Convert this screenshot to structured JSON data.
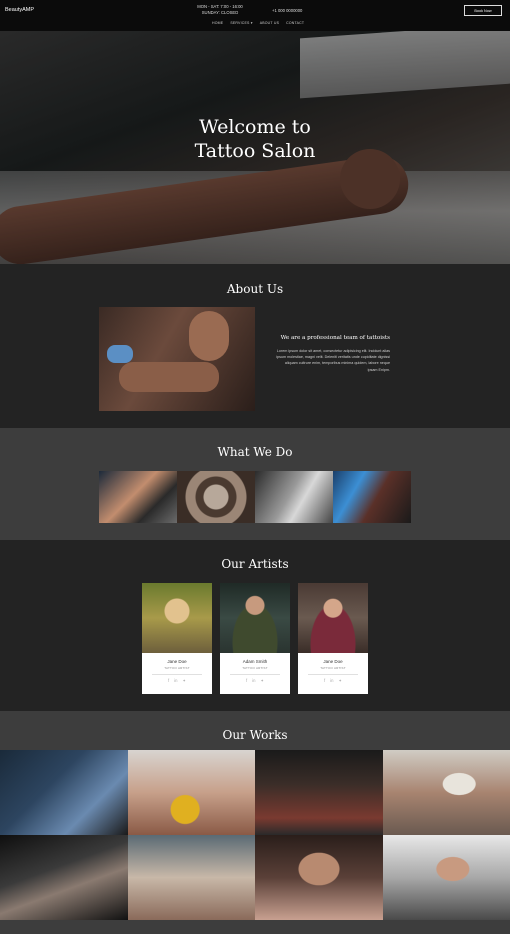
{
  "header": {
    "logo": "BeautyAMP",
    "hours_line1": "MON - SAT: 7:00 - 16:00",
    "hours_line2": "SUNDAY: CLOSED",
    "phone": "+1 000 0000000",
    "book_label": "Book Now",
    "nav": [
      "HOME",
      "SERVICES ▾",
      "ABOUT US",
      "CONTACT"
    ]
  },
  "hero": {
    "title_line1": "Welcome to",
    "title_line2": "Tattoo Salon"
  },
  "about": {
    "title": "About Us",
    "subtitle": "We are a professional team of tattoists",
    "body": "Lorem ipsum dolor sit amet, consectetur adipisicing elit. Incidunt alias ipsum molestiae, magni velit. Deleniti veritatis unde cupiditate dignissi aliquam cultrure enim, temporibus minima quidem, labore neque ipsam Enipm."
  },
  "whatwedo": {
    "title": "What We Do"
  },
  "artists": {
    "title": "Our Artists",
    "items": [
      {
        "name": "Jane Doe",
        "role": "TATTOO ARTIST"
      },
      {
        "name": "Adam Smith",
        "role": "TATTOO ARTIST"
      },
      {
        "name": "Jane Doe",
        "role": "TATTOO ARTIST"
      }
    ]
  },
  "works": {
    "title": "Our Works"
  },
  "colors": {
    "dark": "#232323",
    "mid": "#3d3d3d",
    "header": "#0b0b0b",
    "accent_glove": "#5b8fc4"
  },
  "icons": [
    "facebook-icon",
    "linkedin-icon",
    "twitter-icon"
  ]
}
